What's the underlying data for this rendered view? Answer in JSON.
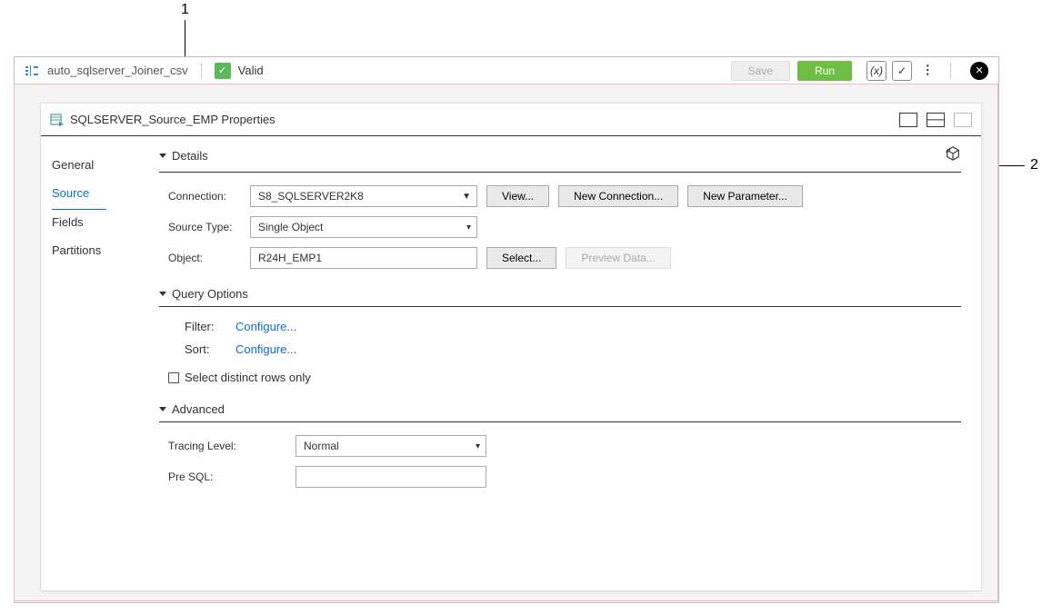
{
  "callouts": {
    "one": "1",
    "two": "2"
  },
  "topbar": {
    "project_name": "auto_sqlserver_Joiner_csv",
    "status_text": "Valid",
    "save_label": "Save",
    "run_label": "Run"
  },
  "panel": {
    "title": "SQLSERVER_Source_EMP Properties"
  },
  "tabs": {
    "general": "General",
    "source": "Source",
    "fields": "Fields",
    "partitions": "Partitions"
  },
  "details": {
    "section_title": "Details",
    "connection_label": "Connection:",
    "connection_value": "S8_SQLSERVER2K8",
    "view_btn": "View...",
    "newconn_btn": "New Connection...",
    "newparam_btn": "New Parameter...",
    "sourcetype_label": "Source Type:",
    "sourcetype_value": "Single Object",
    "object_label": "Object:",
    "object_value": "R24H_EMP1",
    "select_btn": "Select...",
    "preview_btn": "Preview Data..."
  },
  "query": {
    "section_title": "Query Options",
    "filter_label": "Filter:",
    "sort_label": "Sort:",
    "configure_link": "Configure...",
    "distinct_label": "Select distinct rows only"
  },
  "advanced": {
    "section_title": "Advanced",
    "tracing_label": "Tracing Level:",
    "tracing_value": "Normal",
    "presql_label": "Pre SQL:"
  }
}
